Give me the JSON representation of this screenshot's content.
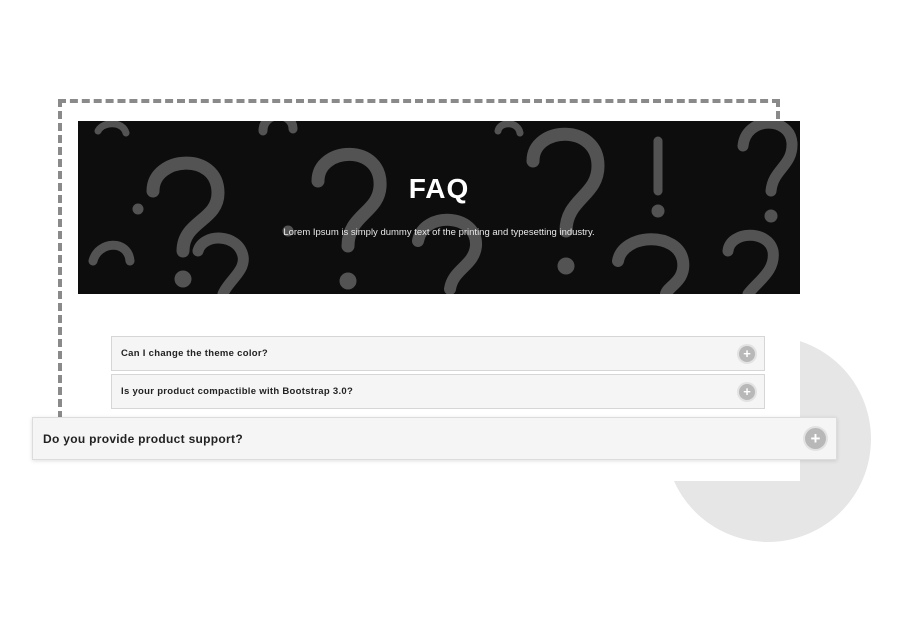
{
  "hero": {
    "title": "FAQ",
    "subtitle": "Lorem Ipsum is simply dummy text of the printing and typesetting industry."
  },
  "faq": {
    "items": [
      {
        "question": "Can I change the theme color?",
        "icon": "plus-circle-icon",
        "expanded": false
      },
      {
        "question": "Is your product compactible with Bootstrap 3.0?",
        "icon": "plus-circle-icon",
        "expanded": false
      },
      {
        "question": "Do you provide product support?",
        "icon": "plus-circle-icon",
        "expanded": false,
        "highlighted": true
      }
    ]
  },
  "colors": {
    "hero_background": "#0d0d0d",
    "item_background": "#f5f5f5",
    "icon_background": "#b8b8b8",
    "frame_dash": "#8a8a8a",
    "decor_circle": "#e6e6e6"
  }
}
